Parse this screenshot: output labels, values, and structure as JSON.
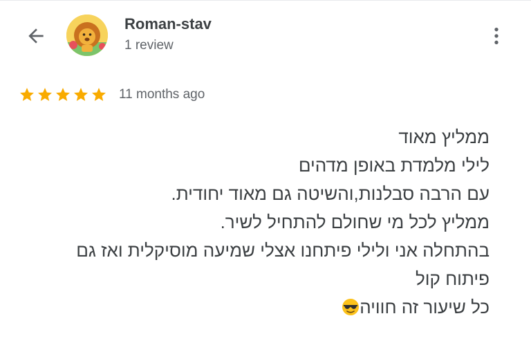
{
  "reviewer": {
    "name": "Roman-stav",
    "review_count": "1 review",
    "avatar_icon": "lion-avatar-icon"
  },
  "header": {
    "back_icon": "arrow-back-icon",
    "menu_icon": "more-vert-icon"
  },
  "rating": {
    "stars": 5,
    "max": 5,
    "color": "#f9ab00"
  },
  "time": "11 months ago",
  "review": {
    "lines": [
      "ממליץ מאוד",
      "לילי מלמדת באופן מדהים",
      "עם הרבה סבלנות,והשיטה גם מאוד יחודית.",
      "ממליץ לכל מי שחולם להתחיל לשיר.",
      "בהתחלה אני ולילי פיתחנו אצלי שמיעה מוסיקלית ואז גם",
      "פיתוח קול",
      "כל שיעור זה חוויה"
    ],
    "emoji": "sunglasses-emoji-icon"
  }
}
